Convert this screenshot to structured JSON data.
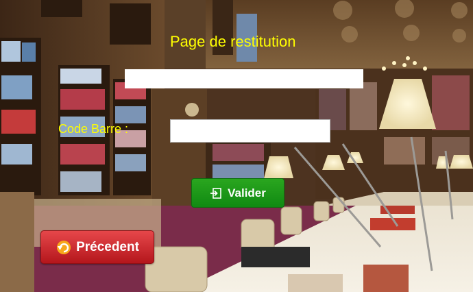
{
  "page": {
    "title": "Page de restitution"
  },
  "form": {
    "code_label": "Code Barre :",
    "code_value": "",
    "code_placeholder": ""
  },
  "buttons": {
    "valider_label": "Valider",
    "precedent_label": "Précedent"
  },
  "colors": {
    "title_text": "#ffff00",
    "valider_bg": "#1e9a18",
    "precedent_bg": "#cc2a2e"
  },
  "icons": {
    "valider": "sign-in-icon",
    "precedent": "undo-arrow-icon"
  }
}
